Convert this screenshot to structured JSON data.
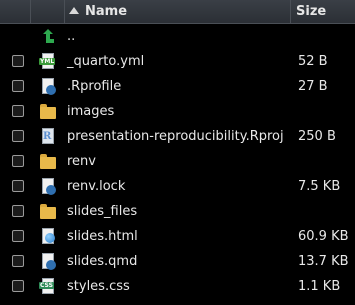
{
  "header": {
    "name_label": "Name",
    "size_label": "Size"
  },
  "colors": {
    "background": "#000000",
    "header_bg": "#2f3339",
    "text": "#e8e8e8",
    "folder": "#e8b94a",
    "up_arrow": "#2ea94f"
  },
  "files": [
    {
      "name": "..",
      "size": "",
      "icon": "up-arrow-icon",
      "checkbox": false
    },
    {
      "name": "_quarto.yml",
      "size": "52 B",
      "icon": "yml-file-icon",
      "checkbox": true
    },
    {
      "name": ".Rprofile",
      "size": "27 B",
      "icon": "r-settings-file-icon",
      "checkbox": true
    },
    {
      "name": "images",
      "size": "",
      "icon": "folder-icon",
      "checkbox": true
    },
    {
      "name": "presentation-reproducibility.Rproj",
      "size": "250 B",
      "icon": "rproj-file-icon",
      "checkbox": true
    },
    {
      "name": "renv",
      "size": "",
      "icon": "folder-icon",
      "checkbox": true
    },
    {
      "name": "renv.lock",
      "size": "7.5 KB",
      "icon": "settings-file-icon",
      "checkbox": true
    },
    {
      "name": "slides_files",
      "size": "",
      "icon": "folder-icon",
      "checkbox": true
    },
    {
      "name": "slides.html",
      "size": "60.9 KB",
      "icon": "html-file-icon",
      "checkbox": true
    },
    {
      "name": "slides.qmd",
      "size": "13.7 KB",
      "icon": "qmd-file-icon",
      "checkbox": true
    },
    {
      "name": "styles.css",
      "size": "1.1 KB",
      "icon": "css-file-icon",
      "checkbox": true
    }
  ]
}
